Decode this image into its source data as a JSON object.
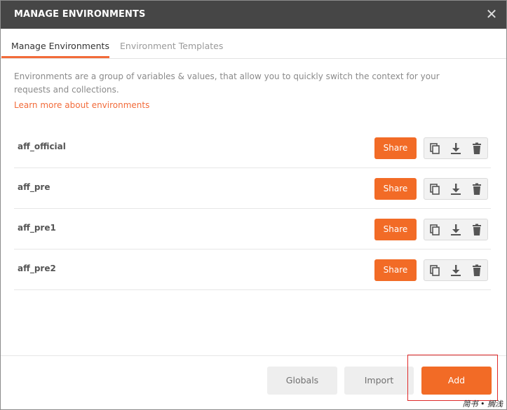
{
  "dialog": {
    "title": "MANAGE ENVIRONMENTS",
    "close_icon": "close-icon"
  },
  "tabs": [
    {
      "label": "Manage Environments",
      "active": true
    },
    {
      "label": "Environment Templates",
      "active": false
    }
  ],
  "description": "Environments are a group of variables & values, that allow you to quickly switch the context for your requests and collections.",
  "learn_more": "Learn more about environments",
  "environments": [
    {
      "name": "aff_official",
      "share_label": "Share"
    },
    {
      "name": "aff_pre",
      "share_label": "Share"
    },
    {
      "name": "aff_pre1",
      "share_label": "Share"
    },
    {
      "name": "aff_pre2",
      "share_label": "Share"
    }
  ],
  "row_icons": [
    "duplicate-icon",
    "download-icon",
    "trash-icon"
  ],
  "footer": {
    "globals_label": "Globals",
    "import_label": "Import",
    "add_label": "Add"
  },
  "watermark": "简书 • 搁浅",
  "colors": {
    "accent": "#f26b26",
    "titlebar": "#464646",
    "highlight_box": "#e02a2a"
  }
}
